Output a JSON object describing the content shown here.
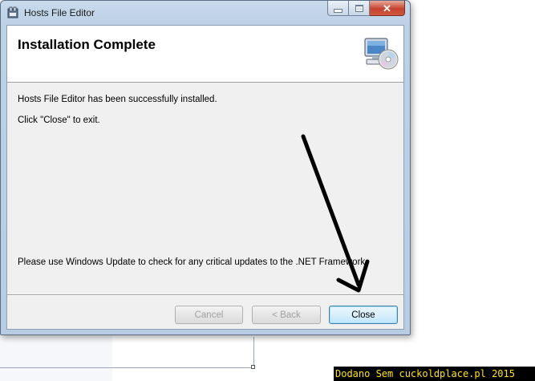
{
  "window": {
    "title": "Hosts File Editor"
  },
  "banner": {
    "title": "Installation Complete",
    "icon": "computer-with-cd-icon"
  },
  "content": {
    "line1": "Hosts File Editor has been successfully installed.",
    "line2": "Click \"Close\" to exit.",
    "line3": "Please use Windows Update to check for any critical updates to the .NET Framework."
  },
  "buttons": {
    "cancel": "Cancel",
    "back": "< Back",
    "close": "Close"
  },
  "watermark": "Dodano Sem cuckoldplace.pl 2015",
  "colors": {
    "close_caption": "#c7432e",
    "primary_button_border": "#3c7fb1",
    "watermark_text": "#ffe600"
  }
}
